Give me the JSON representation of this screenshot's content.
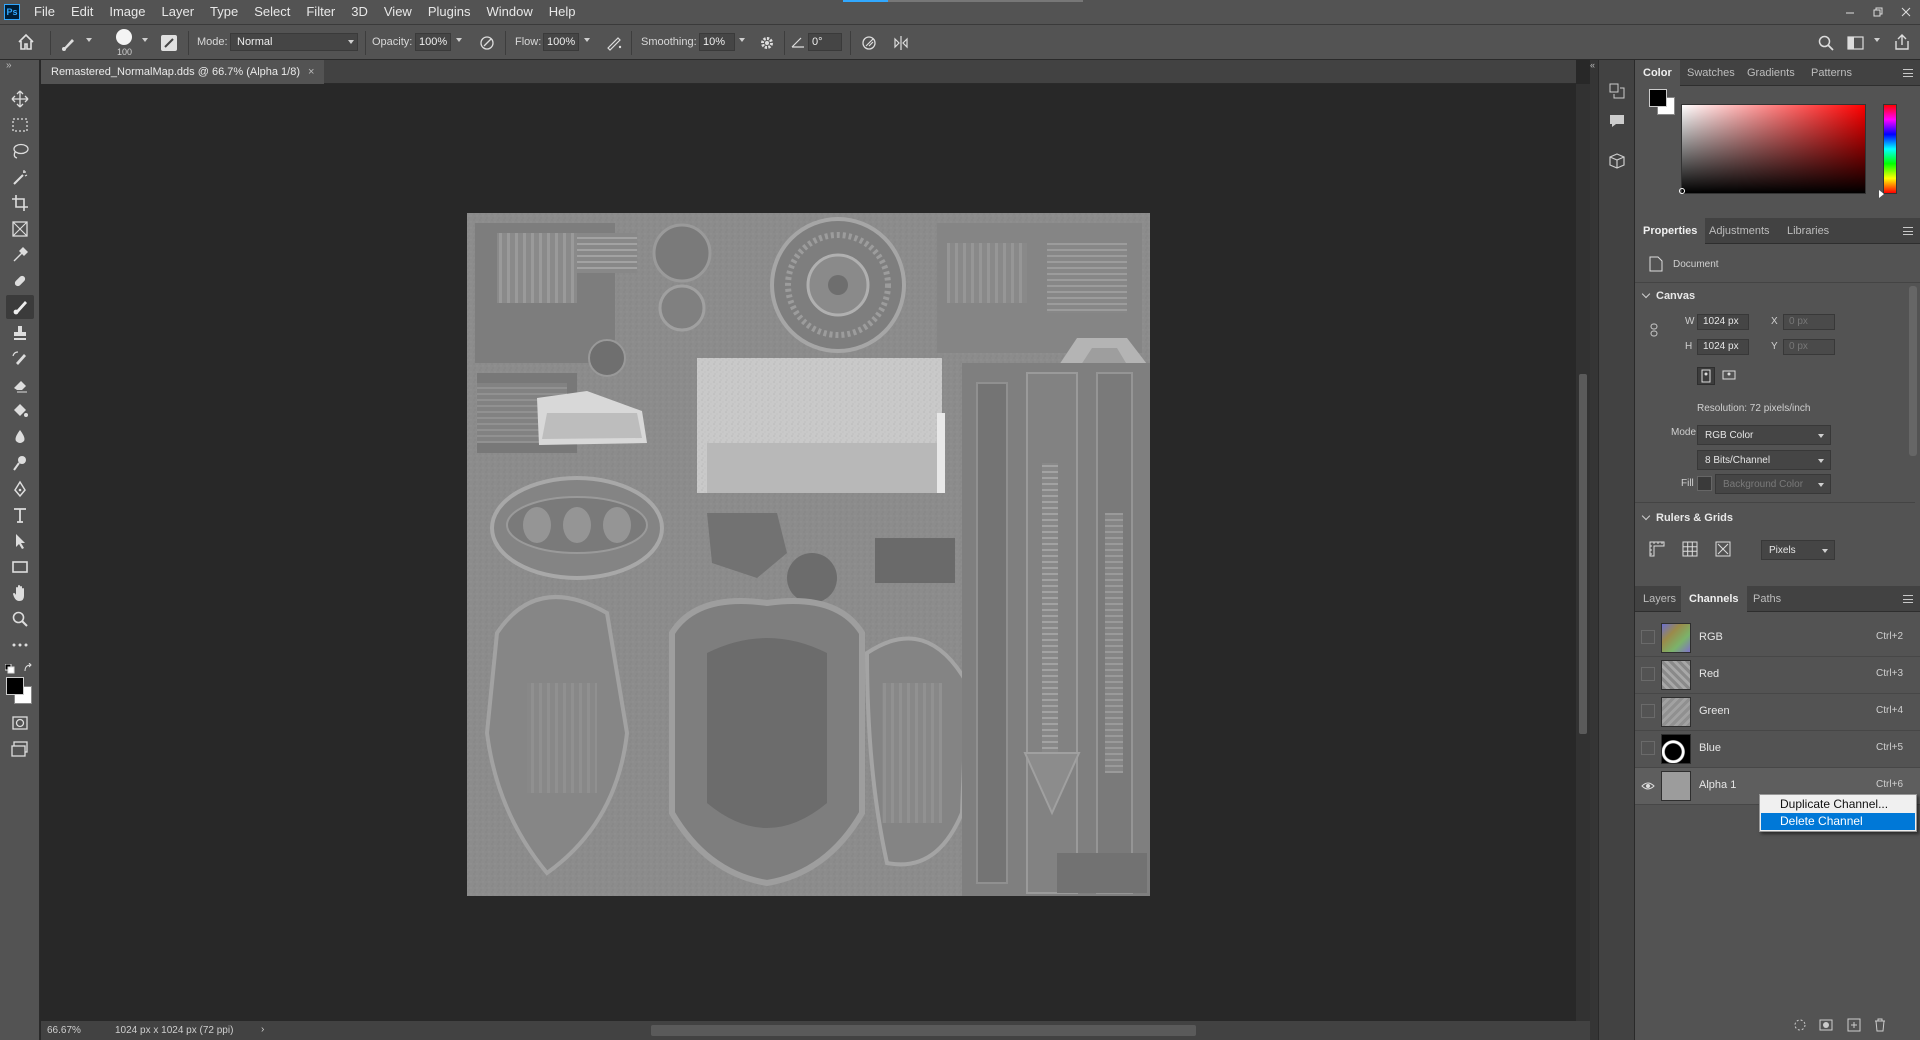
{
  "app": {
    "logo": "Ps",
    "window_controls": [
      "minimize-icon",
      "restore-icon",
      "close-icon"
    ]
  },
  "menu": [
    "File",
    "Edit",
    "Image",
    "Layer",
    "Type",
    "Select",
    "Filter",
    "3D",
    "View",
    "Plugins",
    "Window",
    "Help"
  ],
  "options": {
    "brush_size": "100",
    "mode_label": "Mode:",
    "mode_value": "Normal",
    "opacity_label": "Opacity:",
    "opacity_value": "100%",
    "flow_label": "Flow:",
    "flow_value": "100%",
    "smoothing_label": "Smoothing:",
    "smoothing_value": "10%",
    "angle_value": "0°"
  },
  "document": {
    "tab_title": "Remastered_NormalMap.dds @ 66.7% (Alpha 1/8)",
    "close": "×"
  },
  "status": {
    "zoom": "66.67%",
    "info": "1024 px x 1024 px (72 ppi)",
    "arrow": "›"
  },
  "color_panel": {
    "tabs": [
      "Color",
      "Swatches",
      "Gradients",
      "Patterns"
    ],
    "active": "Color",
    "foreground": "#000000",
    "background": "#ffffff",
    "hue_accent": "#ff0000"
  },
  "properties": {
    "tabs": [
      "Properties",
      "Adjustments",
      "Libraries"
    ],
    "doc_label": "Document",
    "canvas_header": "Canvas",
    "w_label": "W",
    "w_value": "1024 px",
    "h_label": "H",
    "h_value": "1024 px",
    "x_label": "X",
    "x_value": "0 px",
    "y_label": "Y",
    "y_value": "0 px",
    "resolution": "Resolution: 72 pixels/inch",
    "mode_label": "Mode",
    "mode_value": "RGB Color",
    "depth_value": "8 Bits/Channel",
    "fill_label": "Fill",
    "fill_value": "Background Color",
    "rulers_header": "Rulers & Grids",
    "units_value": "Pixels"
  },
  "channels_panel": {
    "tabs": [
      "Layers",
      "Channels",
      "Paths"
    ],
    "active": "Channels",
    "rows": [
      {
        "name": "RGB",
        "shortcut": "Ctrl+2",
        "visible": false
      },
      {
        "name": "Red",
        "shortcut": "Ctrl+3",
        "visible": false
      },
      {
        "name": "Green",
        "shortcut": "Ctrl+4",
        "visible": false
      },
      {
        "name": "Blue",
        "shortcut": "Ctrl+5",
        "visible": false
      },
      {
        "name": "Alpha 1",
        "shortcut": "Ctrl+6",
        "visible": true
      }
    ]
  },
  "context_menu": {
    "items": [
      "Duplicate Channel...",
      "Delete Channel"
    ],
    "highlighted": "Delete Channel"
  }
}
